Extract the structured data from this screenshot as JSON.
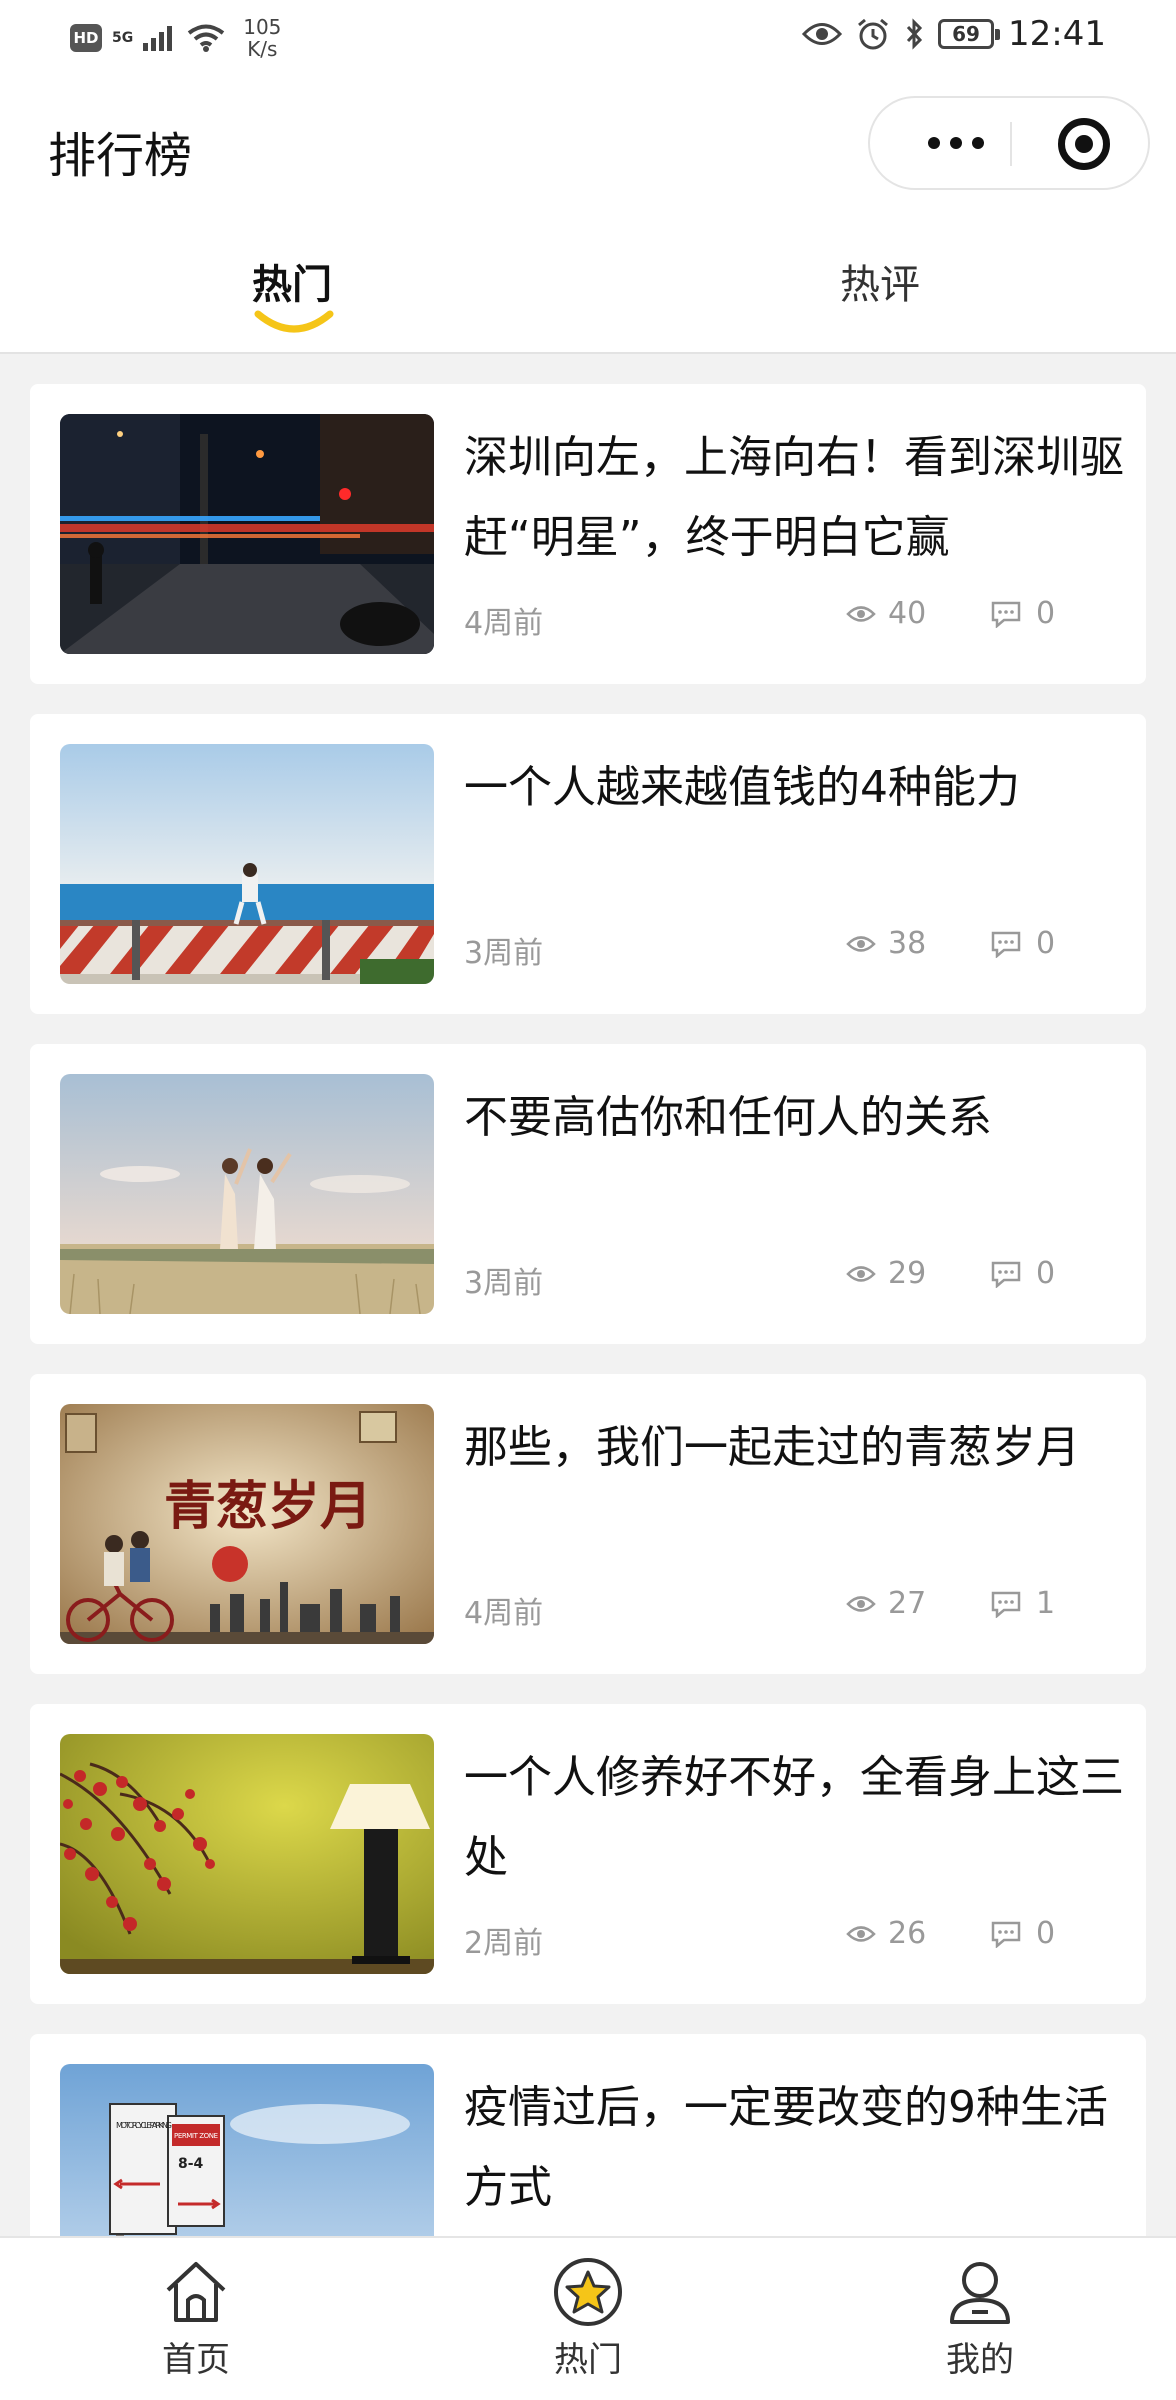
{
  "status_bar": {
    "hd": "HD",
    "network": "5G",
    "speed_value": "105",
    "speed_unit": "K/s",
    "battery": "69",
    "time": "12:41"
  },
  "header": {
    "title": "排行榜"
  },
  "tabs": [
    {
      "label": "热门",
      "active": true
    },
    {
      "label": "热评",
      "active": false
    }
  ],
  "articles": [
    {
      "title": "深圳向左，上海向右！看到深圳驱赶“明星”，终于明白它赢",
      "time": "4周前",
      "views": "40",
      "comments": "0",
      "thumb": "night-street"
    },
    {
      "title": "一个人越来越值钱的4种能力",
      "time": "3周前",
      "views": "38",
      "comments": "0",
      "thumb": "sea-railing"
    },
    {
      "title": "不要高估你和任何人的关系",
      "time": "3周前",
      "views": "29",
      "comments": "0",
      "thumb": "grass-field"
    },
    {
      "title": "那些，我们一起走过的青葱岁月",
      "time": "4周前",
      "views": "27",
      "comments": "1",
      "thumb": "youth-poster"
    },
    {
      "title": "一个人修养好不好，全看身上这三处",
      "time": "2周前",
      "views": "26",
      "comments": "0",
      "thumb": "lamp-blossom"
    },
    {
      "title": "疫情过后，一定要改变的9种生活方式",
      "time": "",
      "views": "",
      "comments": "",
      "thumb": "parking-sign"
    }
  ],
  "thumb_texts": {
    "poster_title": "青葱岁月",
    "sign_top": "MOTORCYCLE PARKING",
    "sign_permit": "PERMIT ZONE",
    "sign_hours": "8-4"
  },
  "tabbar": [
    {
      "label": "首页",
      "icon": "home-icon"
    },
    {
      "label": "热门",
      "icon": "star-badge-icon"
    },
    {
      "label": "我的",
      "icon": "user-icon"
    }
  ],
  "colors": {
    "accent": "#f5c518",
    "text": "#111111",
    "meta": "#999999",
    "background": "#f2f2f2"
  }
}
